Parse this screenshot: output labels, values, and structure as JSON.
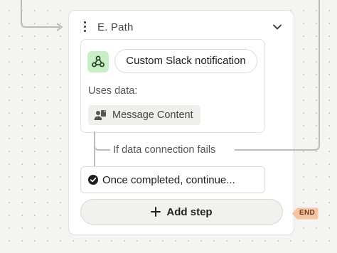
{
  "canvas": {
    "colors": {
      "background": "#f4f4f2",
      "connector": "#bdbdb8",
      "accent_green": "#c8eec6",
      "end_badge": "#f6c3a3"
    }
  },
  "path_card": {
    "title": "E. Path",
    "icons": {
      "menu": "kebab-icon",
      "collapse": "chevron-down-icon"
    },
    "step": {
      "app_icon": "webhook-icon",
      "action_label": "Custom Slack notification",
      "uses_data_label": "Uses data:",
      "data_chip": {
        "icon": "person-doc-icon",
        "label": "Message Content"
      }
    },
    "failure_branch_label": "If data connection fails",
    "continue_row": {
      "icon": "check-circle-icon",
      "label": "Once completed, continue..."
    },
    "add_step": {
      "icon": "plus-icon",
      "label": "Add step"
    }
  },
  "end_marker": {
    "label": "END"
  }
}
